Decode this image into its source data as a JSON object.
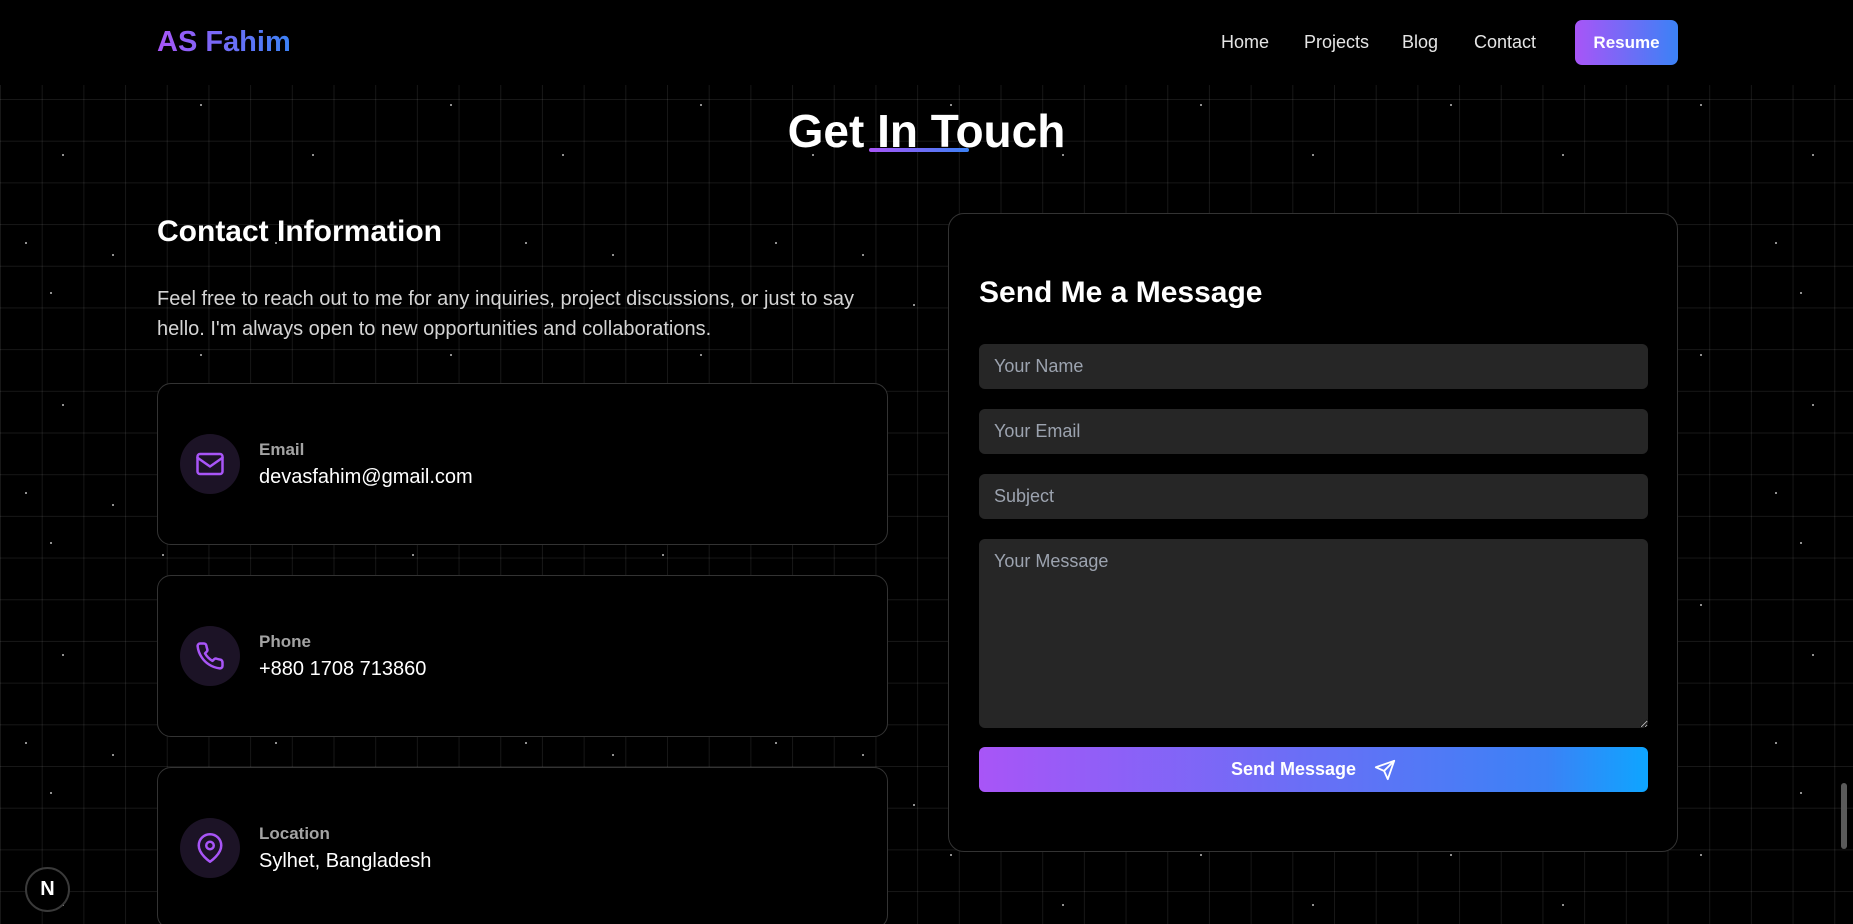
{
  "header": {
    "logo": "AS Fahim",
    "nav": [
      "Home",
      "Projects",
      "Blog",
      "Contact"
    ],
    "resume_label": "Resume"
  },
  "section": {
    "title": "Get In Touch"
  },
  "contact_info": {
    "heading": "Contact Information",
    "description": "Feel free to reach out to me for any inquiries, project discussions, or just to say hello. I'm always open to new opportunities and collaborations.",
    "items": [
      {
        "label": "Email",
        "value": "devasfahim@gmail.com",
        "icon": "mail-icon"
      },
      {
        "label": "Phone",
        "value": "+880 1708 713860",
        "icon": "phone-icon"
      },
      {
        "label": "Location",
        "value": "Sylhet, Bangladesh",
        "icon": "map-pin-icon"
      }
    ]
  },
  "form": {
    "title": "Send Me a Message",
    "name_placeholder": "Your Name",
    "email_placeholder": "Your Email",
    "subject_placeholder": "Subject",
    "message_placeholder": "Your Message",
    "submit_label": "Send Message"
  },
  "badge": {
    "letter": "N"
  },
  "colors": {
    "accent_purple": "#a855f7",
    "accent_blue": "#3b82f6",
    "background": "#000000",
    "input_bg": "#262626"
  }
}
